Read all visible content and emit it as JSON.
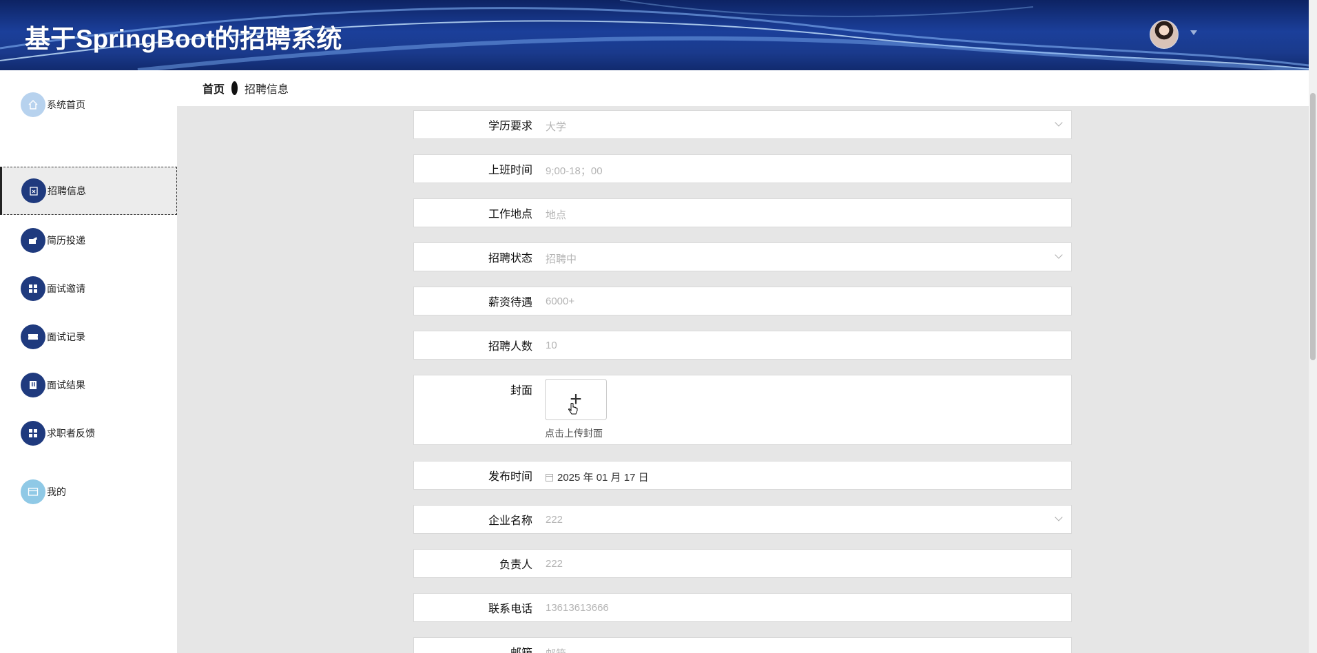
{
  "header": {
    "title": "基于SpringBoot的招聘系统"
  },
  "sidebar": {
    "items": [
      {
        "label": "系统首页",
        "icon": "home-icon"
      },
      {
        "label": "招聘信息",
        "icon": "clipboard-icon"
      },
      {
        "label": "简历投递",
        "icon": "send-icon"
      },
      {
        "label": "面试邀请",
        "icon": "grid-icon"
      },
      {
        "label": "面试记录",
        "icon": "ticket-icon"
      },
      {
        "label": "面试结果",
        "icon": "book-icon"
      },
      {
        "label": "求职者反馈",
        "icon": "grid-icon"
      },
      {
        "label": "我的",
        "icon": "card-icon"
      }
    ]
  },
  "breadcrumb": {
    "home": "首页",
    "current": "招聘信息"
  },
  "form": {
    "education": {
      "label": "学历要求",
      "value": "大学"
    },
    "work_time": {
      "label": "上班时间",
      "placeholder": "9;00-18；00"
    },
    "location": {
      "label": "工作地点",
      "placeholder": "地点"
    },
    "status": {
      "label": "招聘状态",
      "value": "招聘中"
    },
    "salary": {
      "label": "薪资待遇",
      "placeholder": "6000+"
    },
    "headcount": {
      "label": "招聘人数",
      "placeholder": "10"
    },
    "cover": {
      "label": "封面",
      "plus": "+",
      "tip": "点击上传封面"
    },
    "publish_date": {
      "label": "发布时间",
      "value": "2025 年 01 月 17 日"
    },
    "company": {
      "label": "企业名称",
      "value": "222"
    },
    "manager": {
      "label": "负责人",
      "placeholder": "222"
    },
    "phone": {
      "label": "联系电话",
      "placeholder": "13613613666"
    },
    "email": {
      "label": "邮箱",
      "placeholder": "邮箱"
    }
  }
}
